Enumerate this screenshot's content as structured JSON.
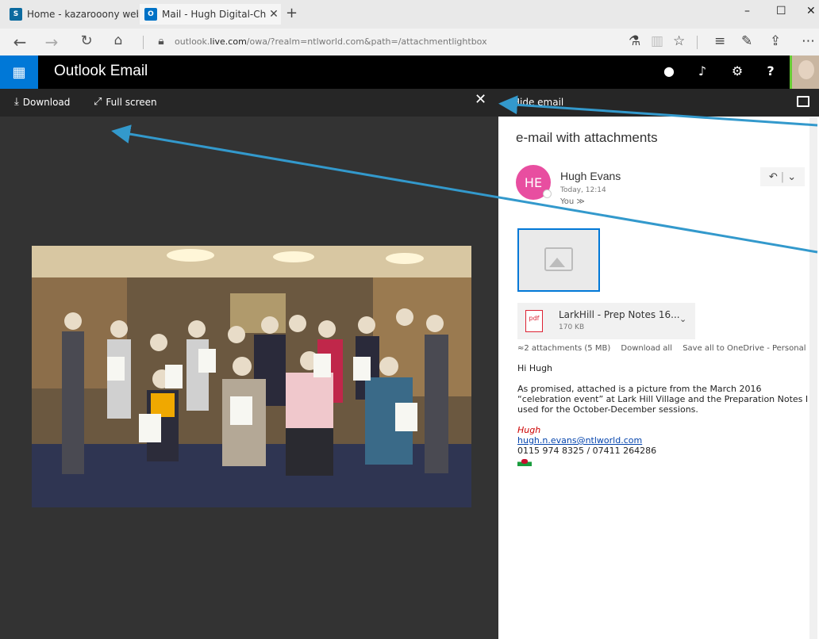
{
  "browser": {
    "tabs": [
      {
        "icon": "sharepoint-icon",
        "title": "Home - kazarooony webde"
      },
      {
        "icon": "outlook-icon",
        "title": "Mail - Hugh Digital-Cha"
      }
    ],
    "url_prefix": "outlook.",
    "url_host": "live.com",
    "url_path": "/owa/?realm=ntlworld.com&path=/attachmentlightbox"
  },
  "app": {
    "title": "Outlook Email"
  },
  "toolbar": {
    "download_label": "Download",
    "fullscreen_label": "Full screen",
    "hide_email_label": "Hide email"
  },
  "email": {
    "subject": "e-mail with attachments",
    "sender_initials": "HE",
    "sender_name": "Hugh Evans",
    "time": "Today, 12:14",
    "to": "You ≫",
    "attachment_name": "LarkHill - Prep Notes 16...",
    "attachment_size": "170 KB",
    "attachments_summary": "≈2 attachments (5 MB)",
    "download_all": "Download all",
    "save_all": "Save all to OneDrive - Personal",
    "greeting": "Hi Hugh",
    "body_text": "As promised, attached is a picture from the March 2016 “celebration event” at Lark Hill Village and the Preparation Notes I used for the October-December sessions.",
    "sig_name": "Hugh",
    "sig_email": "hugh.n.evans@ntlworld.com",
    "sig_phone": "0115 974 8325 / 07411 264286"
  },
  "colors": {
    "brand": "#0078d7",
    "avatar": "#e84ea0",
    "arrow": "#3399cc"
  }
}
